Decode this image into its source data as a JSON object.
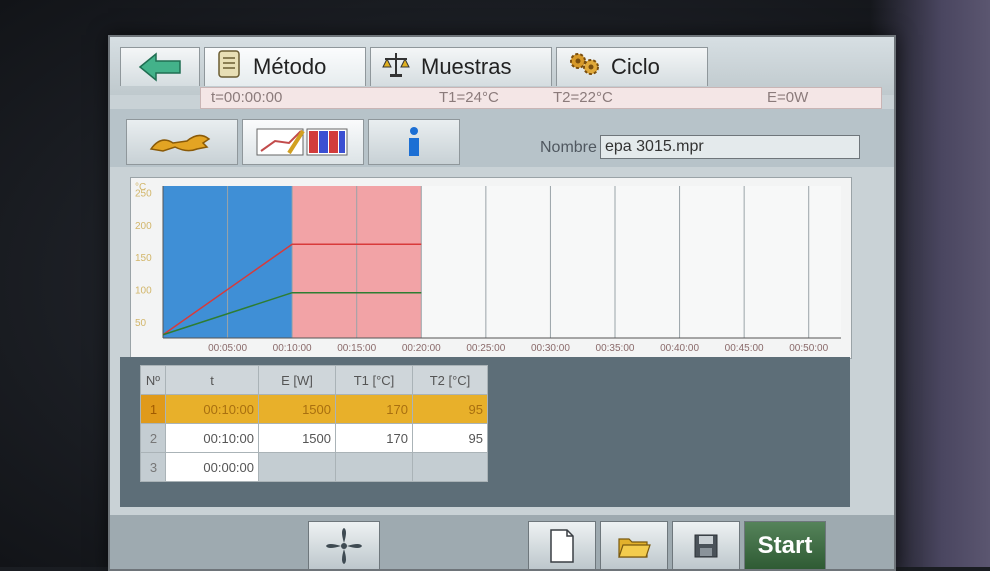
{
  "tabs": {
    "metodo_label": "Método",
    "muestras_label": "Muestras",
    "ciclo_label": "Ciclo"
  },
  "status": {
    "time": "t=00:00:00",
    "t1": "T1=24°C",
    "t2": "T2=22°C",
    "energy": "E=0W"
  },
  "name_field": {
    "label": "Nombre",
    "value": "epa 3015.mpr"
  },
  "chart_data": {
    "type": "line",
    "ylabel": "°C",
    "y_ticks": [
      "250",
      "200",
      "150",
      "100",
      "50"
    ],
    "ylim": [
      25,
      260
    ],
    "x_ticks": [
      "00:05:00",
      "00:10:00",
      "00:15:00",
      "00:20:00",
      "00:25:00",
      "00:30:00",
      "00:35:00",
      "00:40:00",
      "00:45:00",
      "00:50:00"
    ],
    "xlim_minutes": [
      0,
      52.5
    ],
    "segments": [
      {
        "from": 0,
        "to": 10,
        "color": "#3f8fd6"
      },
      {
        "from": 10,
        "to": 20,
        "color": "#f2a3a6"
      }
    ],
    "series": [
      {
        "x": [
          0,
          10,
          20
        ],
        "y": [
          30,
          170,
          170
        ],
        "color": "#d83a3a"
      },
      {
        "x": [
          0,
          10,
          20
        ],
        "y": [
          30,
          95,
          95
        ],
        "color": "#2e7d32"
      }
    ]
  },
  "table": {
    "headers": [
      "Nº",
      "t",
      "E [W]",
      "T1 [°C]",
      "T2 [°C]"
    ],
    "rows": [
      [
        "1",
        "00:10:00",
        "1500",
        "170",
        "95"
      ],
      [
        "2",
        "00:10:00",
        "1500",
        "170",
        "95"
      ],
      [
        "3",
        "00:00:00",
        "",
        "",
        ""
      ]
    ]
  },
  "buttons": {
    "start_label": "Start"
  },
  "icons": {
    "back": "back-arrow-icon",
    "method": "scroll-icon",
    "samples": "scale-icon",
    "cycle": "gears-icon",
    "tools": "wrench-icon",
    "program": "chart-table-icon",
    "info": "info-icon",
    "fan": "fan-icon",
    "new": "new-file-icon",
    "open": "open-folder-icon",
    "save": "save-icon"
  }
}
